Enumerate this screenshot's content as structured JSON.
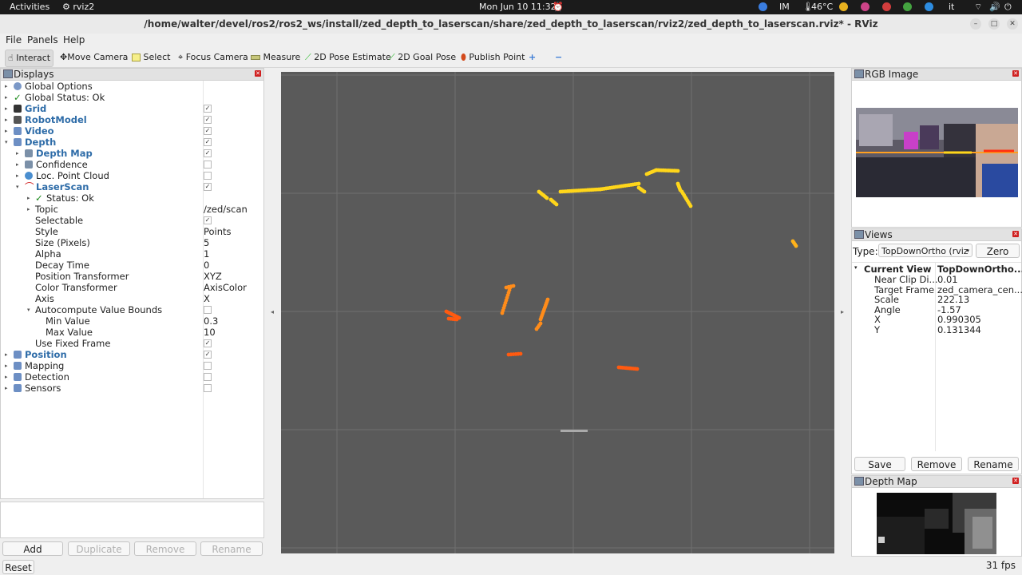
{
  "topbar": {
    "activities": "Activities",
    "app_name": "rviz2",
    "clock": "Mon Jun 10  11:32",
    "temperature": "46°C",
    "lang": "it"
  },
  "window": {
    "title": "/home/walter/devel/ros2/ros2_ws/install/zed_depth_to_laserscan/share/zed_depth_to_laserscan/rviz2/zed_depth_to_laserscan.rviz* - RViz"
  },
  "menu": {
    "file": "File",
    "panels": "Panels",
    "help": "Help"
  },
  "toolbar": {
    "interact": "Interact",
    "move_camera": "Move Camera",
    "select": "Select",
    "focus_camera": "Focus Camera",
    "measure": "Measure",
    "pose_estimate": "2D Pose Estimate",
    "goal_pose": "2D Goal Pose",
    "publish_point": "Publish Point"
  },
  "displays": {
    "title": "Displays",
    "rows": [
      {
        "label": "Global Options"
      },
      {
        "label": "Global Status: Ok"
      },
      {
        "label": "Grid"
      },
      {
        "label": "RobotModel"
      },
      {
        "label": "Video"
      },
      {
        "label": "Depth"
      },
      {
        "label": "Depth Map"
      },
      {
        "label": "Confidence"
      },
      {
        "label": "Loc. Point Cloud"
      },
      {
        "label": "LaserScan"
      },
      {
        "label": "Status: Ok"
      },
      {
        "label": "Topic",
        "value": "/zed/scan"
      },
      {
        "label": "Selectable"
      },
      {
        "label": "Style",
        "value": "Points"
      },
      {
        "label": "Size (Pixels)",
        "value": "5"
      },
      {
        "label": "Alpha",
        "value": "1"
      },
      {
        "label": "Decay Time",
        "value": "0"
      },
      {
        "label": "Position Transformer",
        "value": "XYZ"
      },
      {
        "label": "Color Transformer",
        "value": "AxisColor"
      },
      {
        "label": "Axis",
        "value": "X"
      },
      {
        "label": "Autocompute Value Bounds"
      },
      {
        "label": "Min Value",
        "value": "0.3"
      },
      {
        "label": "Max Value",
        "value": "10"
      },
      {
        "label": "Use Fixed Frame"
      },
      {
        "label": "Position"
      },
      {
        "label": "Mapping"
      },
      {
        "label": "Detection"
      },
      {
        "label": "Sensors"
      }
    ],
    "add": "Add",
    "duplicate": "Duplicate",
    "remove": "Remove",
    "rename": "Rename"
  },
  "reset": "Reset",
  "fps": "31 fps",
  "rgb_panel": {
    "title": "RGB Image"
  },
  "views": {
    "title": "Views",
    "type_label": "Type:",
    "type_value": "TopDownOrtho (rviz",
    "zero": "Zero",
    "current_view": "Current View",
    "current_type": "TopDownOrtho...",
    "props": [
      {
        "k": "Near Clip Di...",
        "v": "0.01"
      },
      {
        "k": "Target Frame",
        "v": "zed_camera_cen..."
      },
      {
        "k": "Scale",
        "v": "222.13"
      },
      {
        "k": "Angle",
        "v": "-1.57"
      },
      {
        "k": "X",
        "v": "0.990305"
      },
      {
        "k": "Y",
        "v": "0.131344"
      }
    ],
    "save": "Save",
    "remove": "Remove",
    "rename": "Rename"
  },
  "depth_panel": {
    "title": "Depth Map"
  },
  "colors": {
    "scan_near": "#ff5a10",
    "scan_mid": "#ff8c1a",
    "scan_far": "#ffd61a",
    "grid": "#707070",
    "panel_link": "#2e6ca8"
  }
}
